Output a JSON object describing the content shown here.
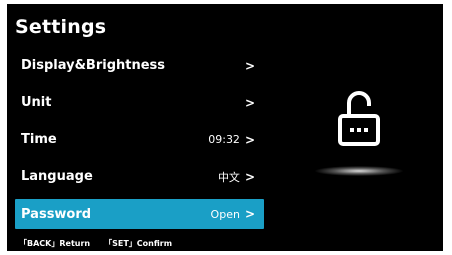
{
  "header": {
    "title": "Settings"
  },
  "menu": {
    "items": [
      {
        "label": "Display&Brightness",
        "value": "",
        "chevron": ">"
      },
      {
        "label": "Unit",
        "value": "",
        "chevron": ">"
      },
      {
        "label": "Time",
        "value": "09:32",
        "chevron": ">"
      },
      {
        "label": "Language",
        "value": "中文",
        "chevron": ">"
      },
      {
        "label": "Password",
        "value": "Open",
        "chevron": ">"
      }
    ],
    "selected_index": 4
  },
  "footer": {
    "back_hint": "「BACK」Return",
    "set_hint": "「SET」Confirm"
  },
  "icons": {
    "lock": "unlocked-padlock-icon"
  },
  "colors": {
    "background": "#000000",
    "selection": "#1a9fc6",
    "text": "#ffffff"
  }
}
